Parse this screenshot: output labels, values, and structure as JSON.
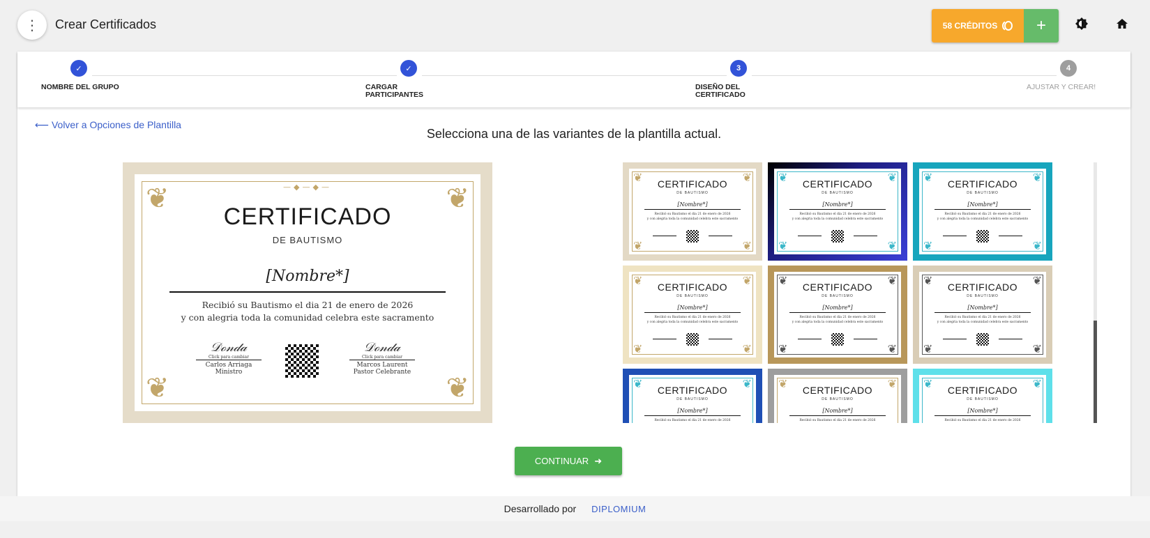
{
  "header": {
    "title": "Crear Certificados",
    "credits_label": "58 CRÉDITOS",
    "add_label": "+"
  },
  "stepper": {
    "steps": [
      {
        "number": "✓",
        "label": "NOMBRE DEL GRUPO",
        "state": "done"
      },
      {
        "number": "✓",
        "label_line1": "CARGAR",
        "label_line2": "PARTICIPANTES",
        "state": "done"
      },
      {
        "number": "3",
        "label_line1": "DISEÑO DEL",
        "label_line2": "CERTIFICADO",
        "state": "active"
      },
      {
        "number": "4",
        "label": "AJUSTAR Y CREAR!",
        "state": "pending"
      }
    ]
  },
  "main": {
    "back_link": "Volver a Opciones de Plantilla",
    "instruction": "Selecciona una de las variantes de la plantilla actual.",
    "continue_label": "CONTINUAR"
  },
  "certificate": {
    "title": "CERTIFICADO",
    "subtitle": "DE BAUTISMO",
    "name_placeholder": "[Nombre*]",
    "line1": "Recibió su Bautismo el dia 21 de enero de 2026",
    "line2": "y con alegria toda la comunidad celebra este sacramento",
    "signer1_note": "Click para cambiar",
    "signer1_name": "Carlos Arriaga",
    "signer1_role": "Ministro",
    "signer2_note": "Click para cambiar",
    "signer2_name": "Marcos Laurent",
    "signer2_role": "Pastor Celebrante"
  },
  "variants": [
    {
      "bg": "#e3d9c5",
      "accent": "#c2a66a"
    },
    {
      "bg": "#2a2fd0",
      "accent": "#3bb7c9",
      "gradient": "linear-gradient(135deg,#000 0%,#1d1d80 40%,#3a3fd6 100%)"
    },
    {
      "bg": "#17a5bd",
      "accent": "#3bb7c9"
    },
    {
      "bg": "#efe3c2",
      "accent": "#c2a66a"
    },
    {
      "bg": "#b8975a",
      "accent": "#555555"
    },
    {
      "bg": "#d9cdb6",
      "accent": "#555555"
    },
    {
      "bg": "#1f4fb5",
      "accent": "#3bb7c9"
    },
    {
      "bg": "#9e9e9e",
      "accent": "#c2a66a"
    },
    {
      "bg": "#5ee0ea",
      "accent": "#3bb7c9"
    }
  ],
  "footer": {
    "developed_by": "Desarrollado por",
    "brand": "DIPLOMIUM"
  },
  "colors": {
    "primary": "#3253d8",
    "credits": "#f7a82c",
    "success": "#4caf50",
    "link": "#3b5fc9"
  }
}
